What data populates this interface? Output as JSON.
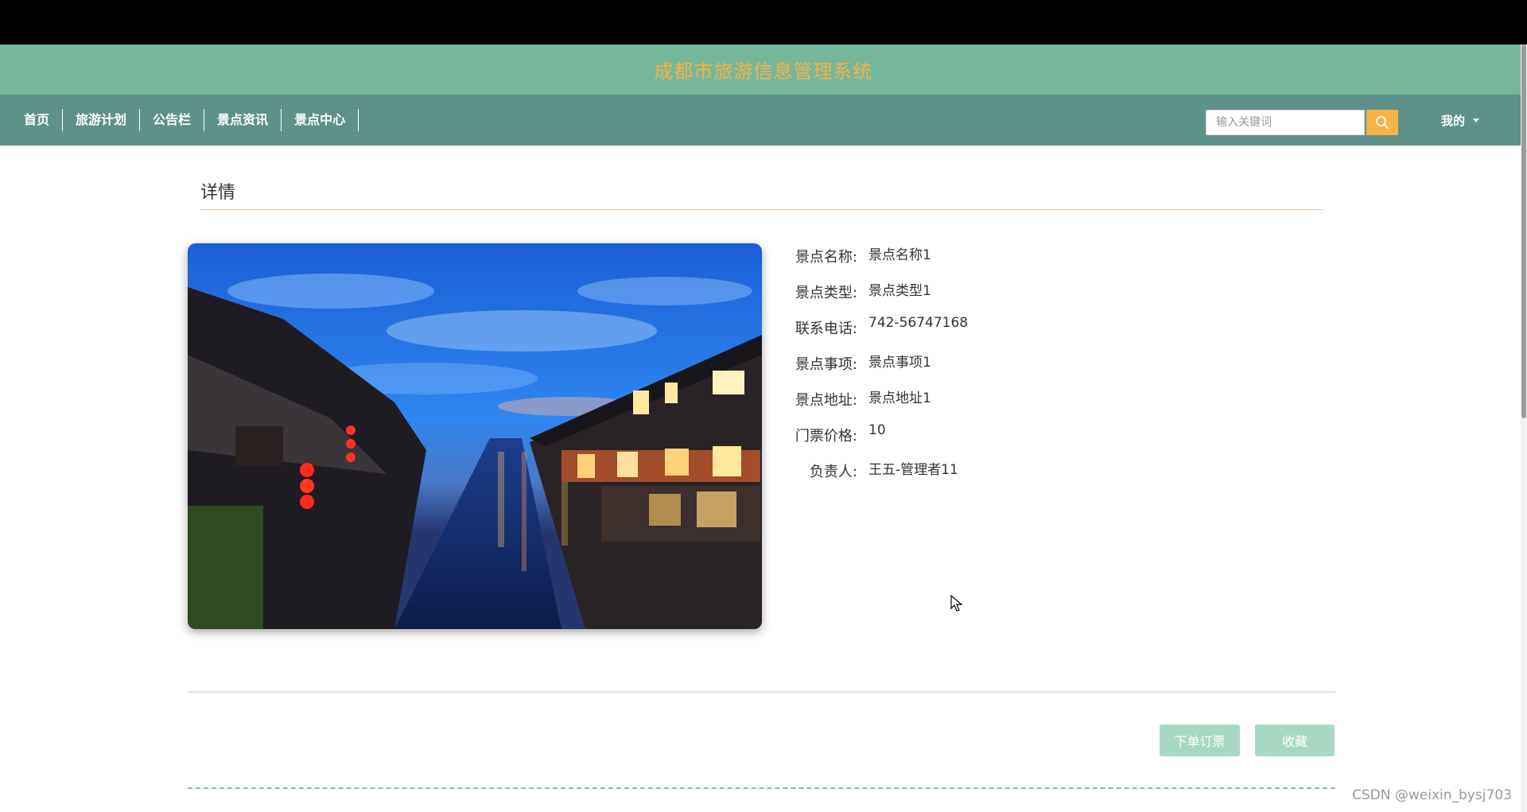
{
  "header": {
    "site_title": "成都市旅游信息管理系统"
  },
  "nav": {
    "items": [
      {
        "label": "首页"
      },
      {
        "label": "旅游计划"
      },
      {
        "label": "公告栏"
      },
      {
        "label": "景点资讯"
      },
      {
        "label": "景点中心"
      }
    ],
    "search_placeholder": "输入关键词",
    "search_value": "",
    "user_menu_label": "我的",
    "search_icon": "search-icon",
    "caret_icon": "caret-down-icon"
  },
  "detail": {
    "section_title": "详情",
    "photo_icon": "scenic-photo",
    "fields": [
      {
        "label": "景点名称:",
        "value": "景点名称1"
      },
      {
        "label": "景点类型:",
        "value": "景点类型1"
      },
      {
        "label": "联系电话:",
        "value": "742-56747168"
      },
      {
        "label": "景点事项:",
        "value": "景点事项1"
      },
      {
        "label": "景点地址:",
        "value": "景点地址1"
      },
      {
        "label": "门票价格:",
        "value": "10"
      },
      {
        "label": "负责人:",
        "value": "王五-管理者11"
      }
    ]
  },
  "actions": {
    "order_label": "下单订票",
    "favorite_label": "收藏"
  },
  "watermark": "CSDN @weixin_bysj703",
  "colors": {
    "banner": "#77b89c",
    "title_text": "#f7b149",
    "navbar": "#5e9189",
    "search_button": "#f7b149",
    "action_button": "#a8d8c4",
    "underline": "#e7c98f"
  }
}
